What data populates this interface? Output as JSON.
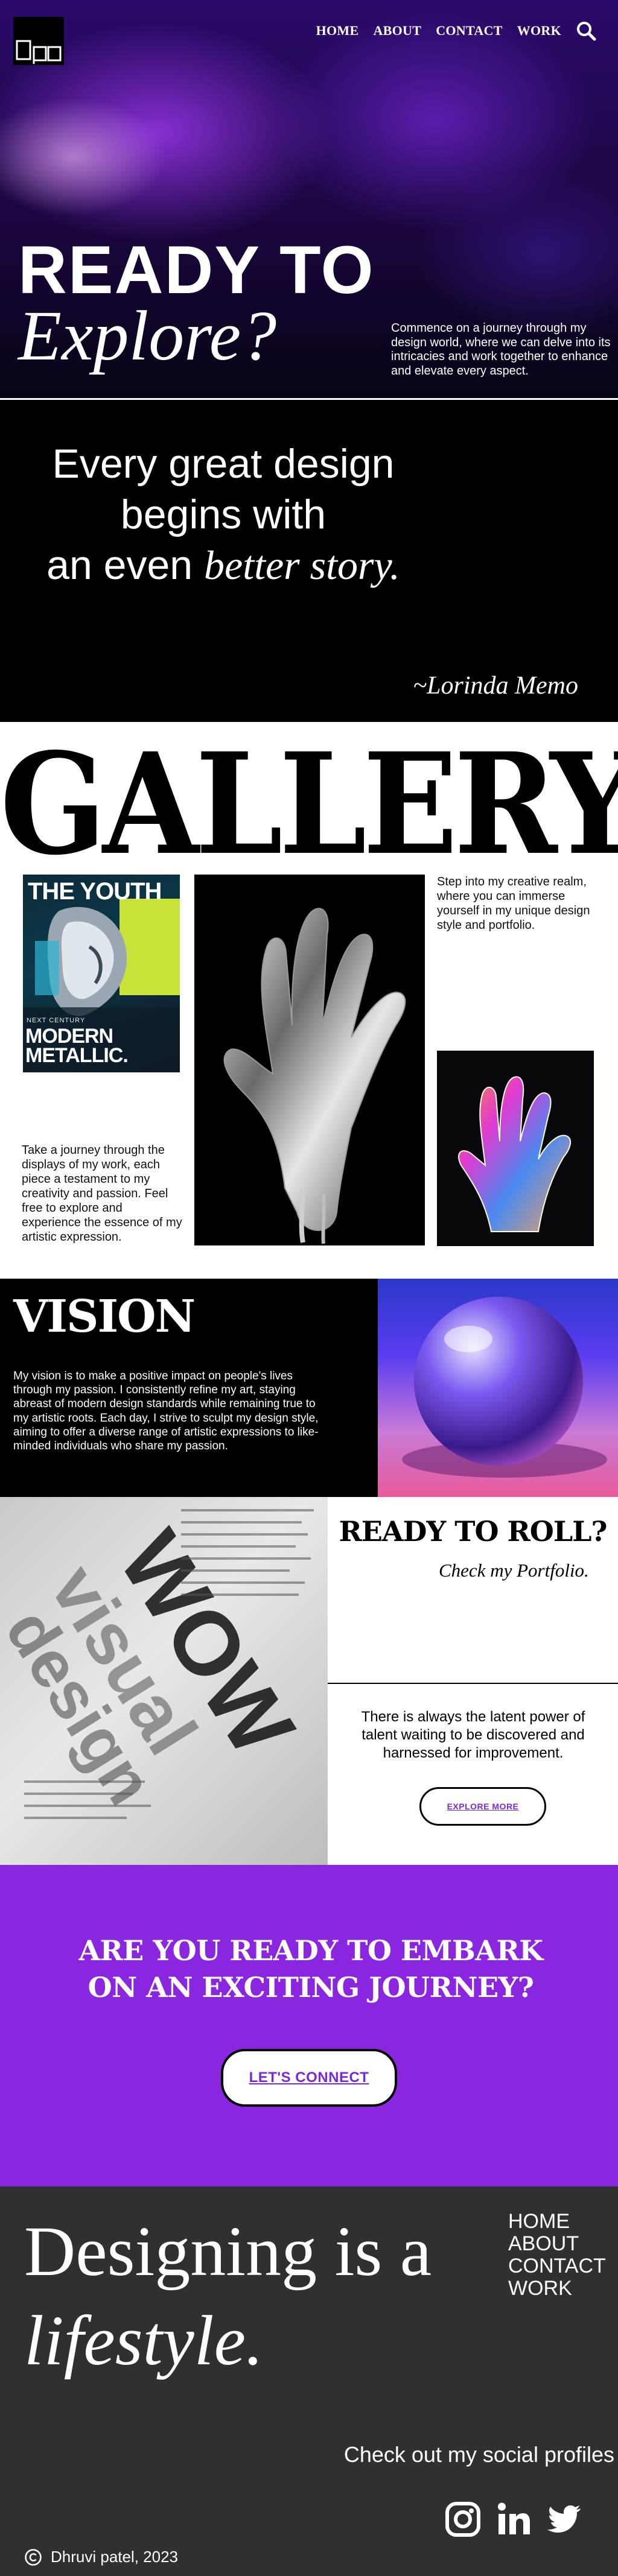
{
  "nav": {
    "items": [
      "HOME",
      "ABOUT",
      "CONTACT",
      "WORK"
    ]
  },
  "hero": {
    "title_line1": "READY TO",
    "title_line2": "Explore?",
    "description": "Commence on a journey through my design world, where we can delve into its intricacies and work together to enhance and elevate every aspect."
  },
  "quote": {
    "line1": "Every great design",
    "line2": "begins with",
    "line3_plain": "an even ",
    "line3_italic": "better story.",
    "author": "~Lorinda Memo"
  },
  "gallery": {
    "title": "GALLERY",
    "text_right": "Step into my creative realm, where you can immerse yourself in my unique design style and portfolio.",
    "text_left": "Take a journey through the displays of my work, each piece a testament to my creativity and passion. Feel free to explore and experience the essence of my artistic expression.",
    "poster": {
      "headline": "THE YOUTH",
      "subline": "NEXT CENTURY",
      "big_line1": "MODERN",
      "big_line2": "METALLIC."
    }
  },
  "vision": {
    "title": "VISION",
    "body": "My vision is to make a positive impact on people's lives through my passion. I consistently refine my art, staying abreast of modern design standards while remaining true to my artistic roots. Each day, I strive to sculpt my design style, aiming to offer a diverse range of artistic expressions to like-minded individuals who share my passion."
  },
  "roll": {
    "title": "READY TO ROLL?",
    "subtitle": "Check my Portfolio.",
    "description": "There is always the latent power of talent waiting to be discovered and harnessed for improvement.",
    "button": "EXPLORE MORE"
  },
  "cta": {
    "title": "ARE YOU READY TO EMBARK ON AN EXCITING JOURNEY?",
    "button": "LET'S CONNECT"
  },
  "footer": {
    "big_line1": "Designing is a",
    "big_line2": "lifestyle.",
    "nav": [
      "HOME",
      "ABOUT",
      "CONTACT",
      "WORK"
    ],
    "social_text": "Check out my social profiles",
    "social_icons": [
      "instagram-icon",
      "linkedin-icon",
      "twitter-icon"
    ],
    "copyright": "Dhruvi patel, 2023"
  },
  "colors": {
    "accent_purple": "#8a26e0",
    "button_text_purple": "#7a28d8",
    "footer_bg": "#303030"
  }
}
